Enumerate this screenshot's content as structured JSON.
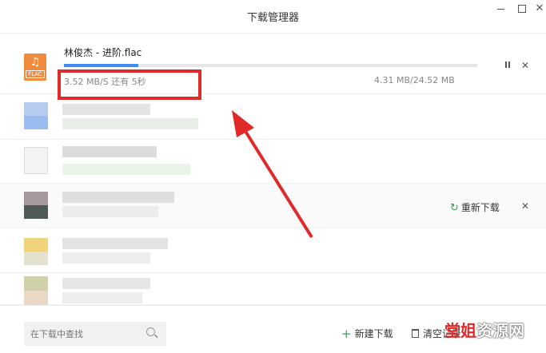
{
  "window": {
    "title": "下载管理器",
    "close_glyph": "✕"
  },
  "active_download": {
    "file_name": "林俊杰 - 进阶.flac",
    "icon_label": "FLAC",
    "icon_glyph": "♫",
    "speed_text": "3.52 MB/S  还有 5秒",
    "size_text": "4.31 MB/24.52 MB",
    "progress": 0.18,
    "close_glyph": "✕"
  },
  "failed_row": {
    "redownload_label": "重新下载",
    "redownload_icon": "↻",
    "close_glyph": "✕"
  },
  "footer": {
    "search_placeholder": "在下载中查找",
    "new_download_label": "新建下载",
    "new_download_icon": "+",
    "clear_records_label": "清空记录"
  },
  "watermark": {
    "brand": "堂姐",
    "rest": "资源网"
  },
  "colors": {
    "accent_blue": "#3d8ef0",
    "highlight_red": "#e02a2a",
    "green": "#2fa84f",
    "flac_orange": "#f08a3c"
  }
}
